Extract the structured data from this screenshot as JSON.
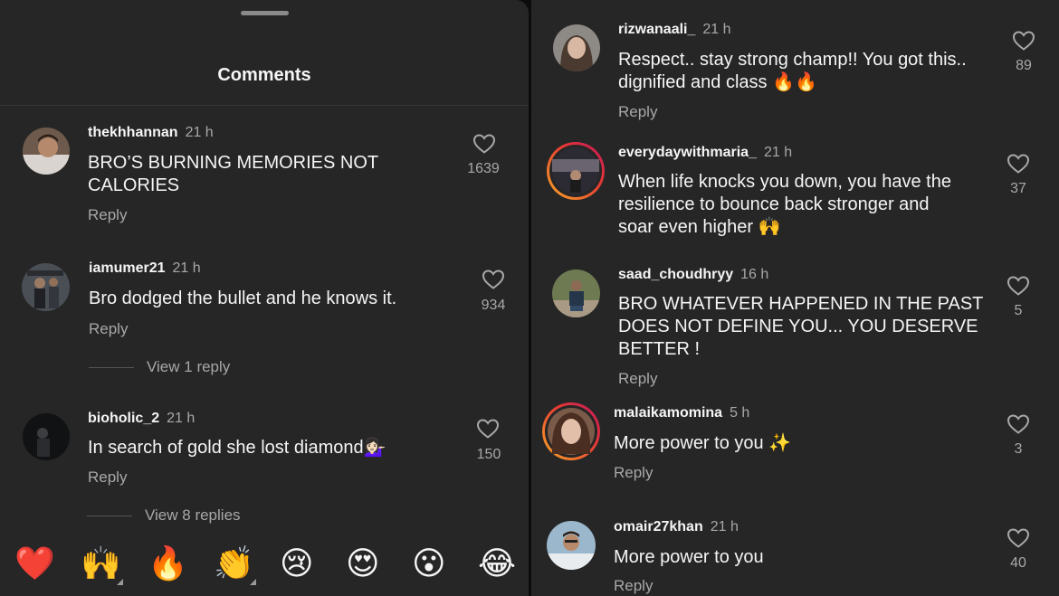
{
  "left_panel": {
    "title": "Comments",
    "comments": [
      {
        "username": "thekhhannan",
        "time": "21 h",
        "text_lines": [
          "BRO’S BURNING MEMORIES NOT",
          "CALORIES"
        ],
        "likes": "1639",
        "reply": "Reply"
      },
      {
        "username": "iamumer21",
        "time": "21 h",
        "text_lines": [
          "Bro dodged the bullet and he knows it."
        ],
        "likes": "934",
        "reply": "Reply",
        "view_replies": "View 1 reply"
      },
      {
        "username": "bioholic_2",
        "time": "21 h",
        "text_lines": [
          "In search of gold she lost diamond💁🏻‍♀️"
        ],
        "likes": "150",
        "reply": "Reply",
        "view_replies": "View 8 replies"
      }
    ],
    "reactions": [
      {
        "name": "heart",
        "glyph": "❤️"
      },
      {
        "name": "raised-hands",
        "glyph": "🙌"
      },
      {
        "name": "fire",
        "glyph": "🔥"
      },
      {
        "name": "clapping-hands",
        "glyph": "👏"
      },
      {
        "name": "crying-face",
        "glyph": "😢"
      },
      {
        "name": "heart-eyes",
        "glyph": "😍"
      },
      {
        "name": "surprised-face",
        "glyph": "😮"
      },
      {
        "name": "tears-of-joy",
        "glyph": "😂"
      }
    ]
  },
  "right_panel": {
    "comments": [
      {
        "username": "rizwanaali_",
        "time": "21 h",
        "text_lines": [
          "Respect.. stay strong champ!! You got this..",
          "dignified and class 🔥🔥"
        ],
        "likes": "89",
        "reply": "Reply"
      },
      {
        "username": "everydaywithmaria_",
        "time": "21 h",
        "text_lines": [
          "When life knocks you down, you have the",
          "resilience to bounce back stronger and",
          "soar even higher 🙌"
        ],
        "likes": "37",
        "reply": "Reply"
      },
      {
        "username": "saad_choudhryy",
        "time": "16 h",
        "text_lines": [
          "BRO WHATEVER HAPPENED IN THE PAST",
          "DOES NOT DEFINE YOU... YOU DESERVE",
          "BETTER !"
        ],
        "likes": "5",
        "reply": "Reply"
      },
      {
        "username": "malaikamomina",
        "time": "5 h",
        "text_lines": [
          "More power to you ✨"
        ],
        "likes": "3",
        "reply": "Reply"
      },
      {
        "username": "omair27khan",
        "time": "21 h",
        "text_lines": [
          "More power to you"
        ],
        "likes": "40",
        "reply": "Reply"
      }
    ]
  },
  "colors": {
    "panel_bg": "#262626",
    "muted": "#a8a8a8",
    "story_ring_start": "#f9a825",
    "story_ring_end": "#c2185b"
  }
}
